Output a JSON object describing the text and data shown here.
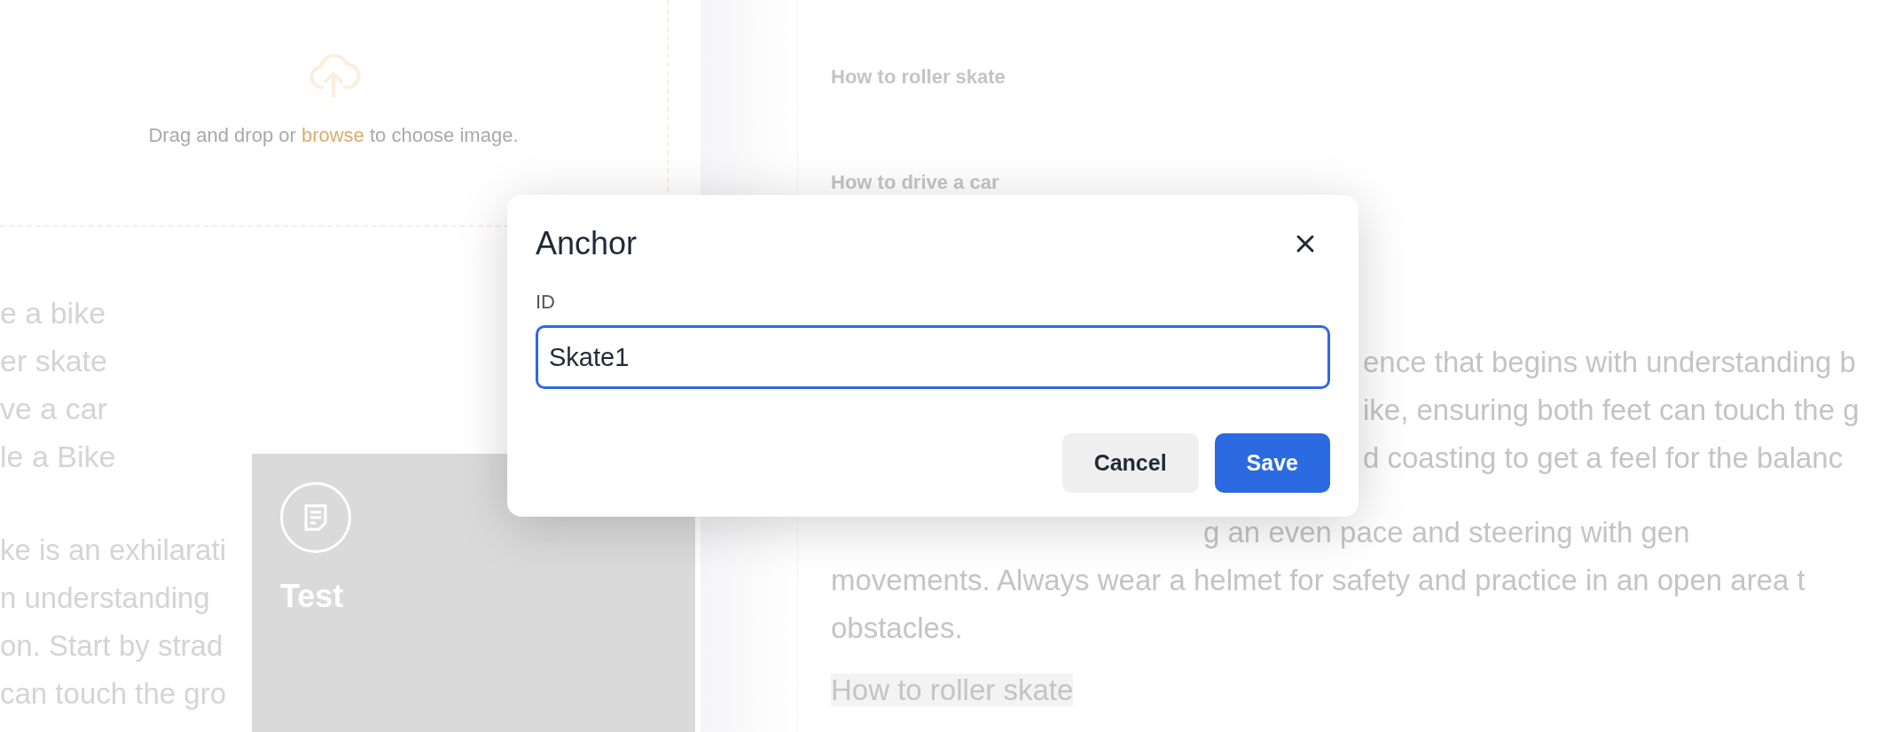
{
  "upload": {
    "before": "Drag and drop or ",
    "link": "browse",
    "after": " to choose image."
  },
  "left_list": [
    "e a bike",
    "er skate",
    "ve a car",
    "le a Bike"
  ],
  "left_paragraph": [
    "ke is an exhilarati",
    "n understanding",
    "on. Start by strad",
    "can touch the gro"
  ],
  "card": {
    "title": "Test"
  },
  "toc": [
    "How to roller skate",
    "How to drive a car"
  ],
  "right_paragraph": [
    "ence that begins with understanding b",
    "ike, ensuring both feet can touch the g",
    "d coasting to get a feel for the balanc",
    "g an even pace and steering with gen",
    "movements. Always wear a helmet for safety and practice in an open area t",
    "obstacles."
  ],
  "right_heading": "How to roller skate",
  "dialog": {
    "title": "Anchor",
    "field": {
      "label": "ID",
      "value": "Skate1",
      "focused": true
    },
    "buttons": [
      {
        "label": "Cancel",
        "kind": "secondary"
      },
      {
        "label": "Save",
        "kind": "primary"
      }
    ]
  }
}
